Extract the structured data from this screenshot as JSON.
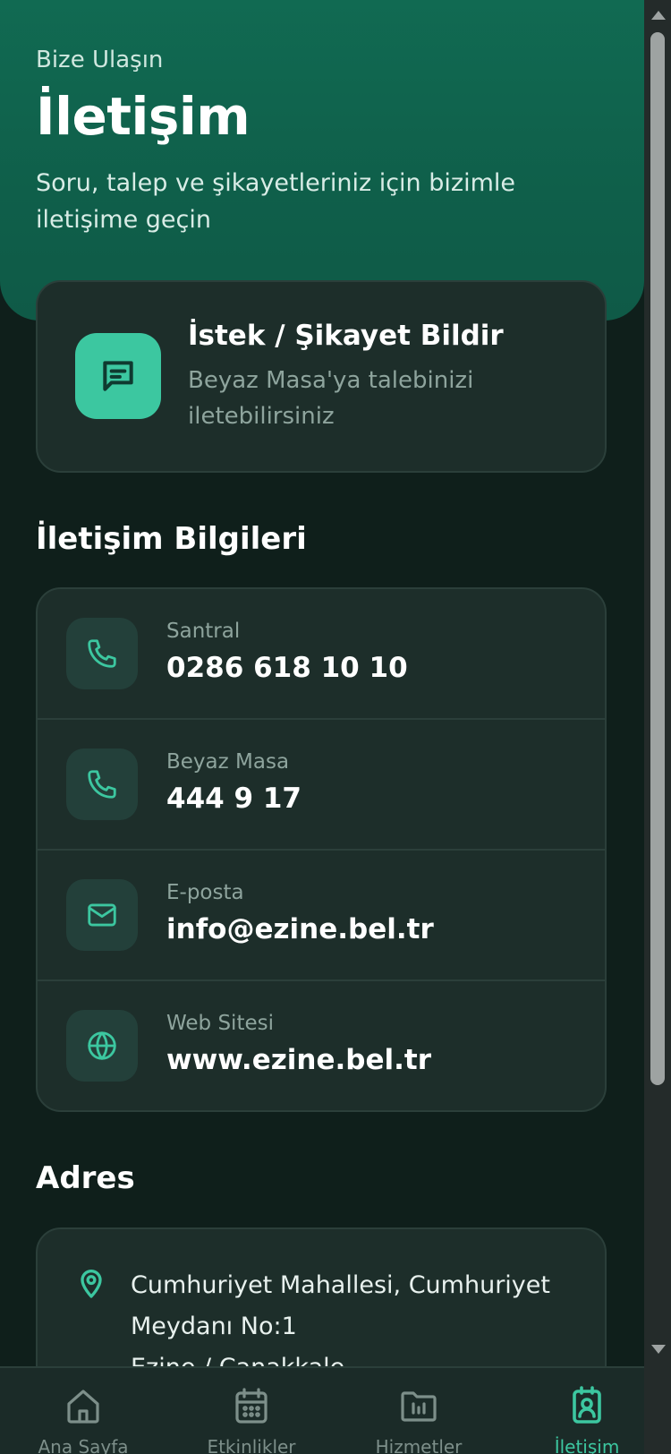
{
  "hero": {
    "kicker": "Bize Ulaşın",
    "title": "İletişim",
    "subtitle": "Soru, talep ve şikayetleriniz için bizimle iletişime geçin"
  },
  "request_card": {
    "title": "İstek / Şikayet Bildir",
    "description": "Beyaz Masa'ya talebinizi iletebilirsiniz",
    "icon": "message-icon"
  },
  "contact": {
    "section_title": "İletişim Bilgileri",
    "items": [
      {
        "label": "Santral",
        "value": "0286 618 10 10",
        "icon": "phone-icon"
      },
      {
        "label": "Beyaz Masa",
        "value": "444 9 17",
        "icon": "phone-icon"
      },
      {
        "label": "E-posta",
        "value": "info@ezine.bel.tr",
        "icon": "mail-icon"
      },
      {
        "label": "Web Sitesi",
        "value": "www.ezine.bel.tr",
        "icon": "globe-icon"
      }
    ]
  },
  "address": {
    "section_title": "Adres",
    "line1": "Cumhuriyet Mahallesi, Cumhuriyet",
    "line2": "Meydanı No:1",
    "line3": "Ezine / Çanakkale",
    "icon": "map-pin-icon"
  },
  "tabbar": {
    "tabs": [
      {
        "label": "Ana Sayfa",
        "icon": "home-icon",
        "active": false
      },
      {
        "label": "Etkinlikler",
        "icon": "calendar-icon",
        "active": false
      },
      {
        "label": "Hizmetler",
        "icon": "folder-icon",
        "active": false
      },
      {
        "label": "İletişim",
        "icon": "contact-icon",
        "active": true
      }
    ]
  },
  "colors": {
    "accent": "#3cc7a0",
    "hero": "#116a52",
    "background": "#0f1f1b",
    "card": "#1d2e2a"
  }
}
